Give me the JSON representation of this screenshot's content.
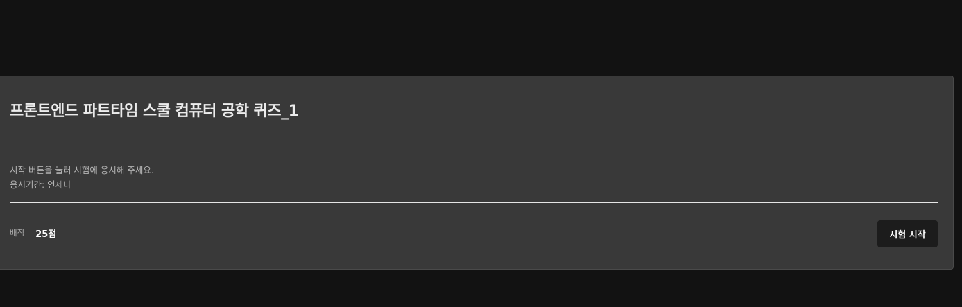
{
  "quiz_card": {
    "title": "프론트엔드 파트타임 스쿨 컴퓨터 공학 퀴즈_1",
    "instruction": "시작 버튼을 눌러 시험에 응시해 주세요.",
    "period": "응시기간: 언제나",
    "score_label": "배점",
    "score_value": "25점",
    "start_button_label": "시험 시작"
  },
  "colors": {
    "background": "#121212",
    "card": "#393939",
    "button": "#1c1c1c",
    "divider": "#e6e6e6"
  }
}
